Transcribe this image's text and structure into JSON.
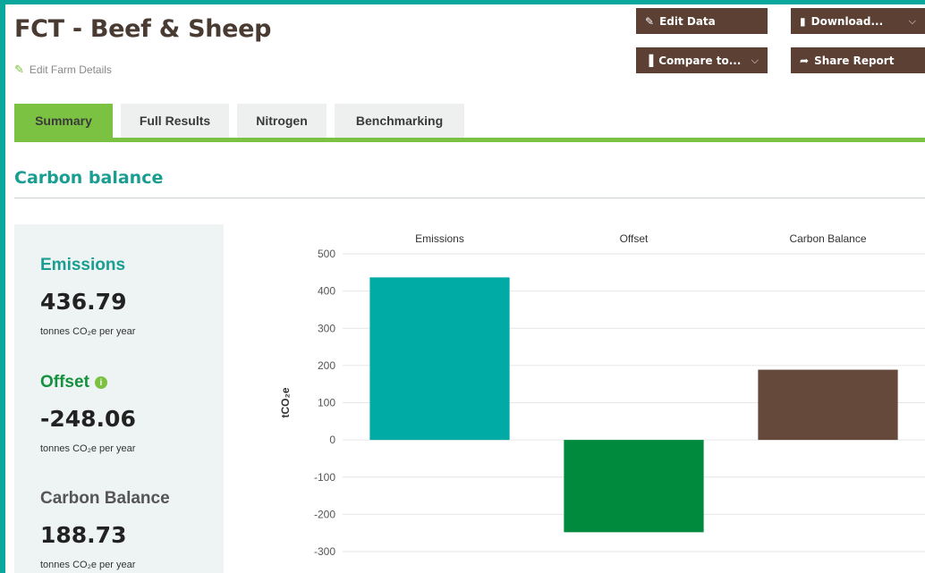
{
  "header": {
    "title": "FCT - Beef & Sheep",
    "edit_farm_label": "Edit Farm Details",
    "buttons": {
      "edit_data": "Edit Data",
      "download": "Download...",
      "compare": "Compare to...",
      "share": "Share Report"
    }
  },
  "tabs": [
    {
      "label": "Summary",
      "active": true
    },
    {
      "label": "Full Results",
      "active": false
    },
    {
      "label": "Nitrogen",
      "active": false
    },
    {
      "label": "Benchmarking",
      "active": false
    }
  ],
  "section": {
    "title": "Carbon balance"
  },
  "stats": {
    "emissions": {
      "label": "Emissions",
      "value": "436.79",
      "unit": "tonnes CO₂e per year",
      "color": "#1a9e92"
    },
    "offset": {
      "label": "Offset",
      "value": "-248.06",
      "unit": "tonnes CO₂e per year",
      "color": "#14913f"
    },
    "balance": {
      "label": "Carbon Balance",
      "value": "188.73",
      "unit": "tonnes CO₂e per year",
      "color": "#555555"
    }
  },
  "colors": {
    "frame": "#0aa89c",
    "brown": "#5c4033",
    "green_accent": "#7cc242"
  },
  "icons": {
    "edit_farm": "edit-icon",
    "edit_data": "edit-icon",
    "download": "file-icon",
    "compare": "bar-chart-icon",
    "share": "share-arrow-icon",
    "offset_info": "info-icon"
  },
  "chart_data": {
    "type": "bar",
    "categories": [
      "Emissions",
      "Offset",
      "Carbon Balance"
    ],
    "values": [
      436.79,
      -248.06,
      188.73
    ],
    "colors": [
      "#00aaa5",
      "#008a3e",
      "#654a3b"
    ],
    "ylabel": "tCO₂e",
    "yticks": [
      500,
      400,
      300,
      200,
      100,
      0,
      -100,
      -200,
      -300
    ],
    "ylim": [
      -300,
      500
    ],
    "grid": true
  }
}
